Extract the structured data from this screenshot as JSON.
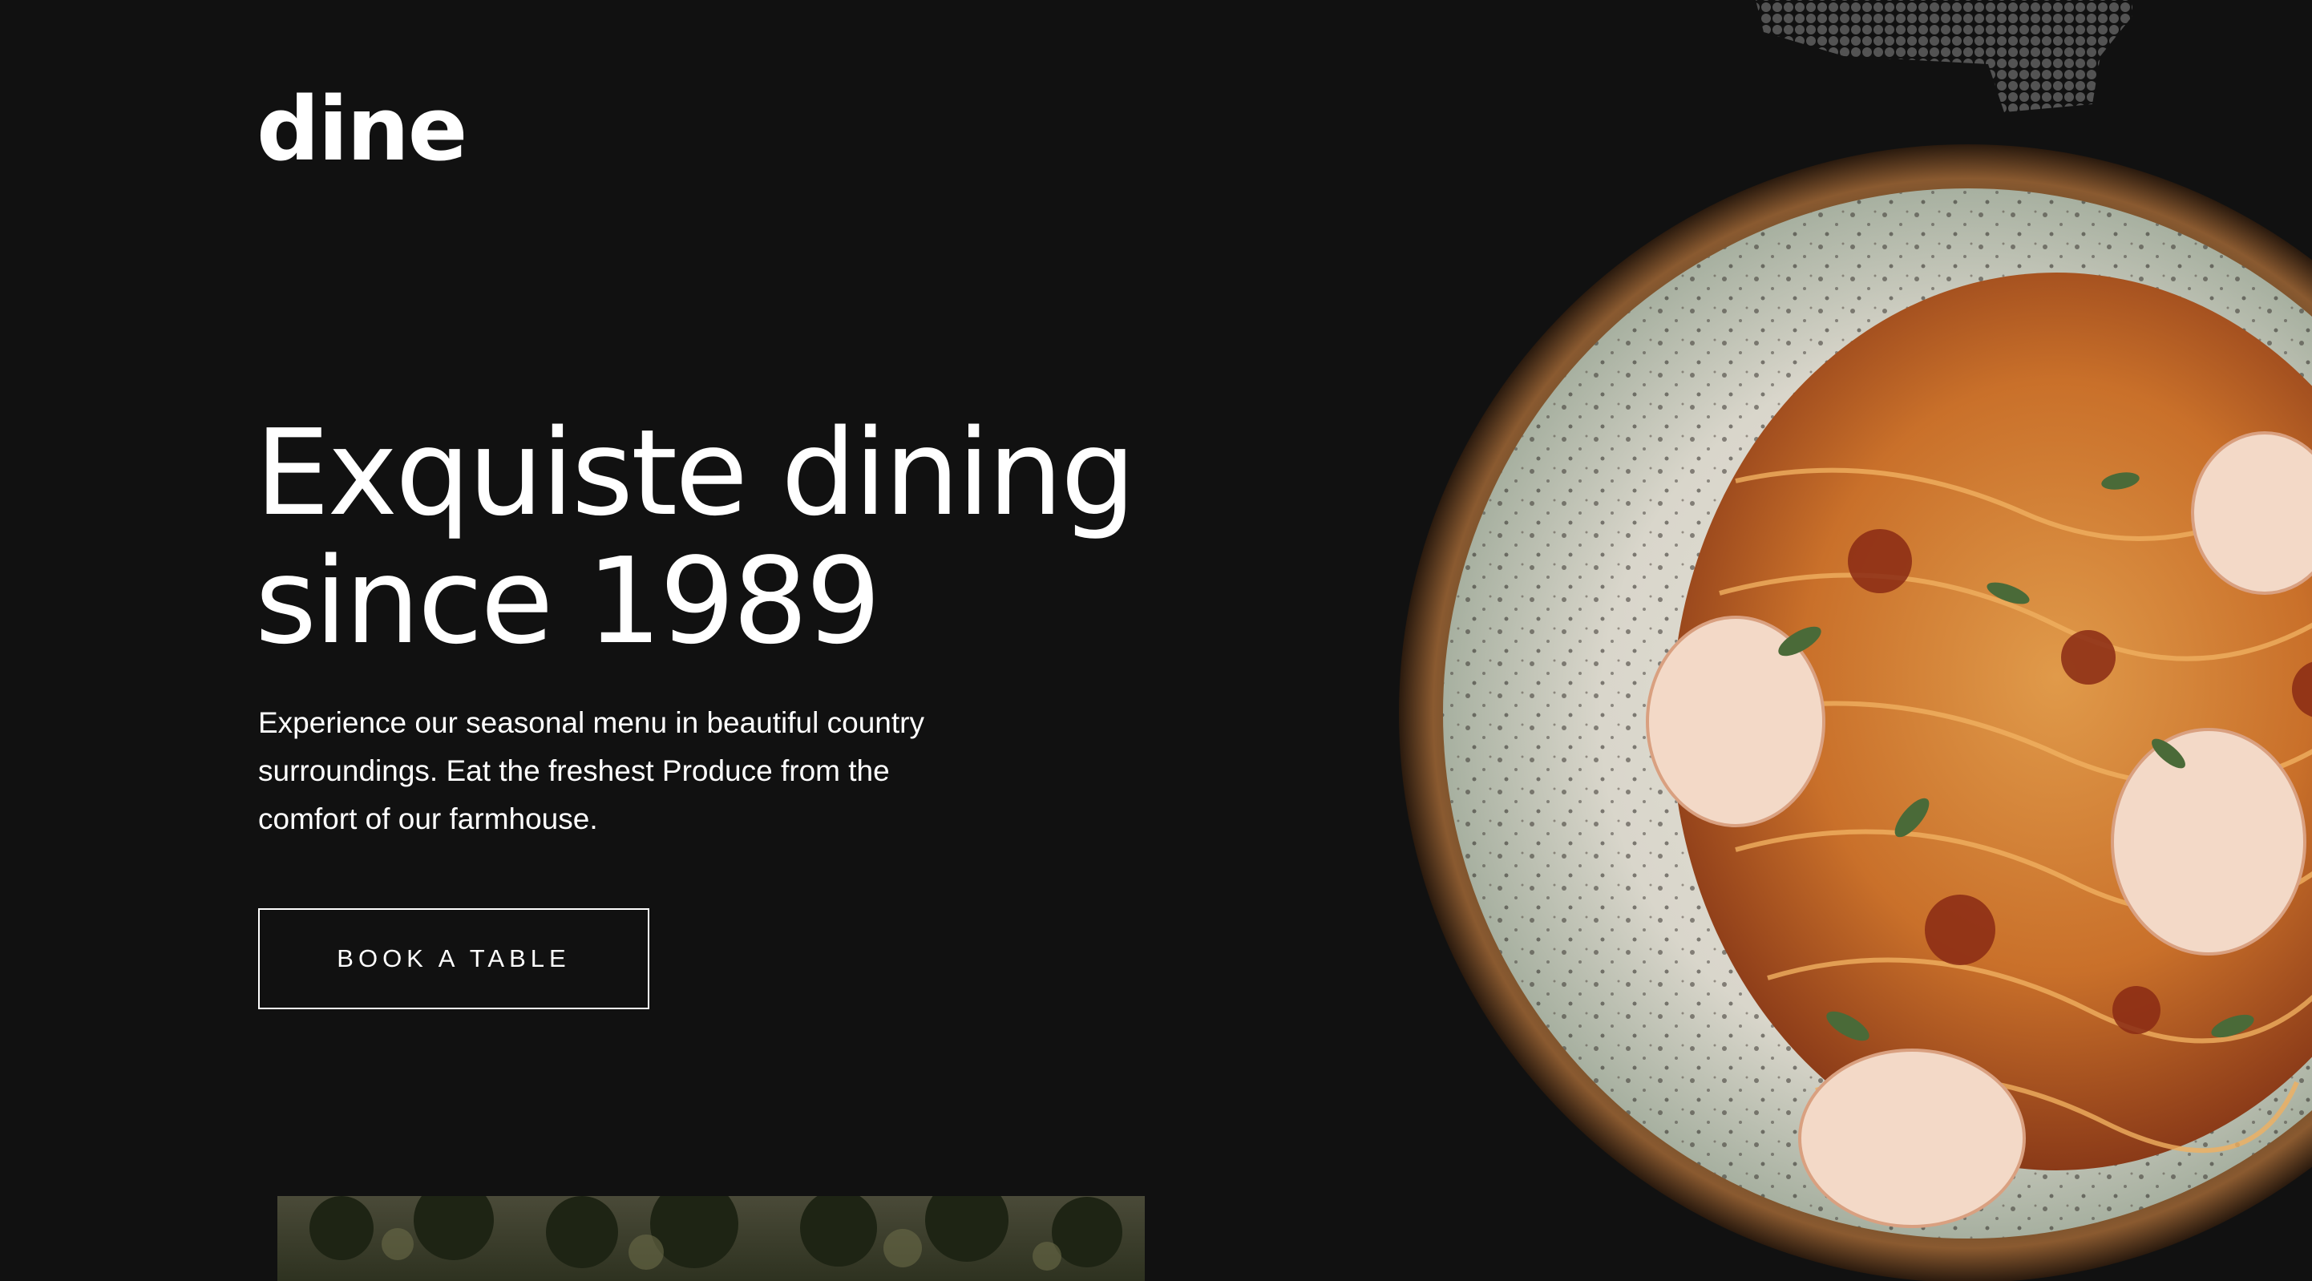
{
  "brand": {
    "logo_text": "dine"
  },
  "hero": {
    "headline": "Exquiste dining since 1989",
    "description": "Experience our seasonal menu in beautiful country surroundings. Eat the freshest Produce from the comfort of our farmhouse.",
    "cta_label": "BOOK A TABLE"
  },
  "colors": {
    "background": "#111111",
    "text": "#ffffff",
    "button_border": "#ffffff"
  },
  "images": {
    "hero_dish": "plate-of-shrimp-pasta",
    "section_preview": "countryside-landscape",
    "decor": "dotted-pattern-shadow"
  }
}
